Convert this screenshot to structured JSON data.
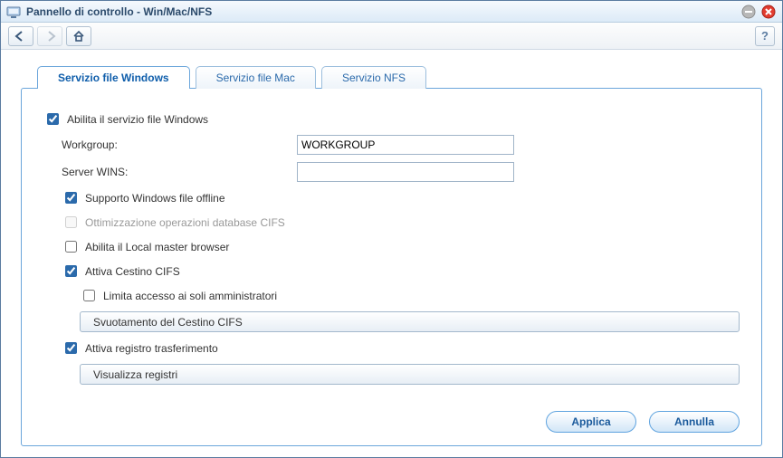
{
  "window": {
    "title": "Pannello di controllo - Win/Mac/NFS"
  },
  "tabs": [
    {
      "label": "Servizio file Windows",
      "active": true
    },
    {
      "label": "Servizio file Mac",
      "active": false
    },
    {
      "label": "Servizio NFS",
      "active": false
    }
  ],
  "form": {
    "enable_windows_label": "Abilita il servizio file Windows",
    "enable_windows_checked": true,
    "workgroup_label": "Workgroup:",
    "workgroup_value": "WORKGROUP",
    "wins_label": "Server WINS:",
    "wins_value": "",
    "offline_support_label": "Supporto Windows file offline",
    "offline_support_checked": true,
    "optimize_cifs_label": "Ottimizzazione operazioni database CIFS",
    "optimize_cifs_checked": false,
    "local_master_label": "Abilita il Local master browser",
    "local_master_checked": false,
    "recycle_label": "Attiva Cestino CIFS",
    "recycle_checked": true,
    "limit_admin_label": "Limita accesso ai soli amministratori",
    "limit_admin_checked": false,
    "empty_recycle_btn": "Svuotamento del Cestino CIFS",
    "transfer_log_label": "Attiva registro trasferimento",
    "transfer_log_checked": true,
    "view_logs_btn": "Visualizza registri"
  },
  "buttons": {
    "apply": "Applica",
    "cancel": "Annulla"
  },
  "help_label": "?"
}
